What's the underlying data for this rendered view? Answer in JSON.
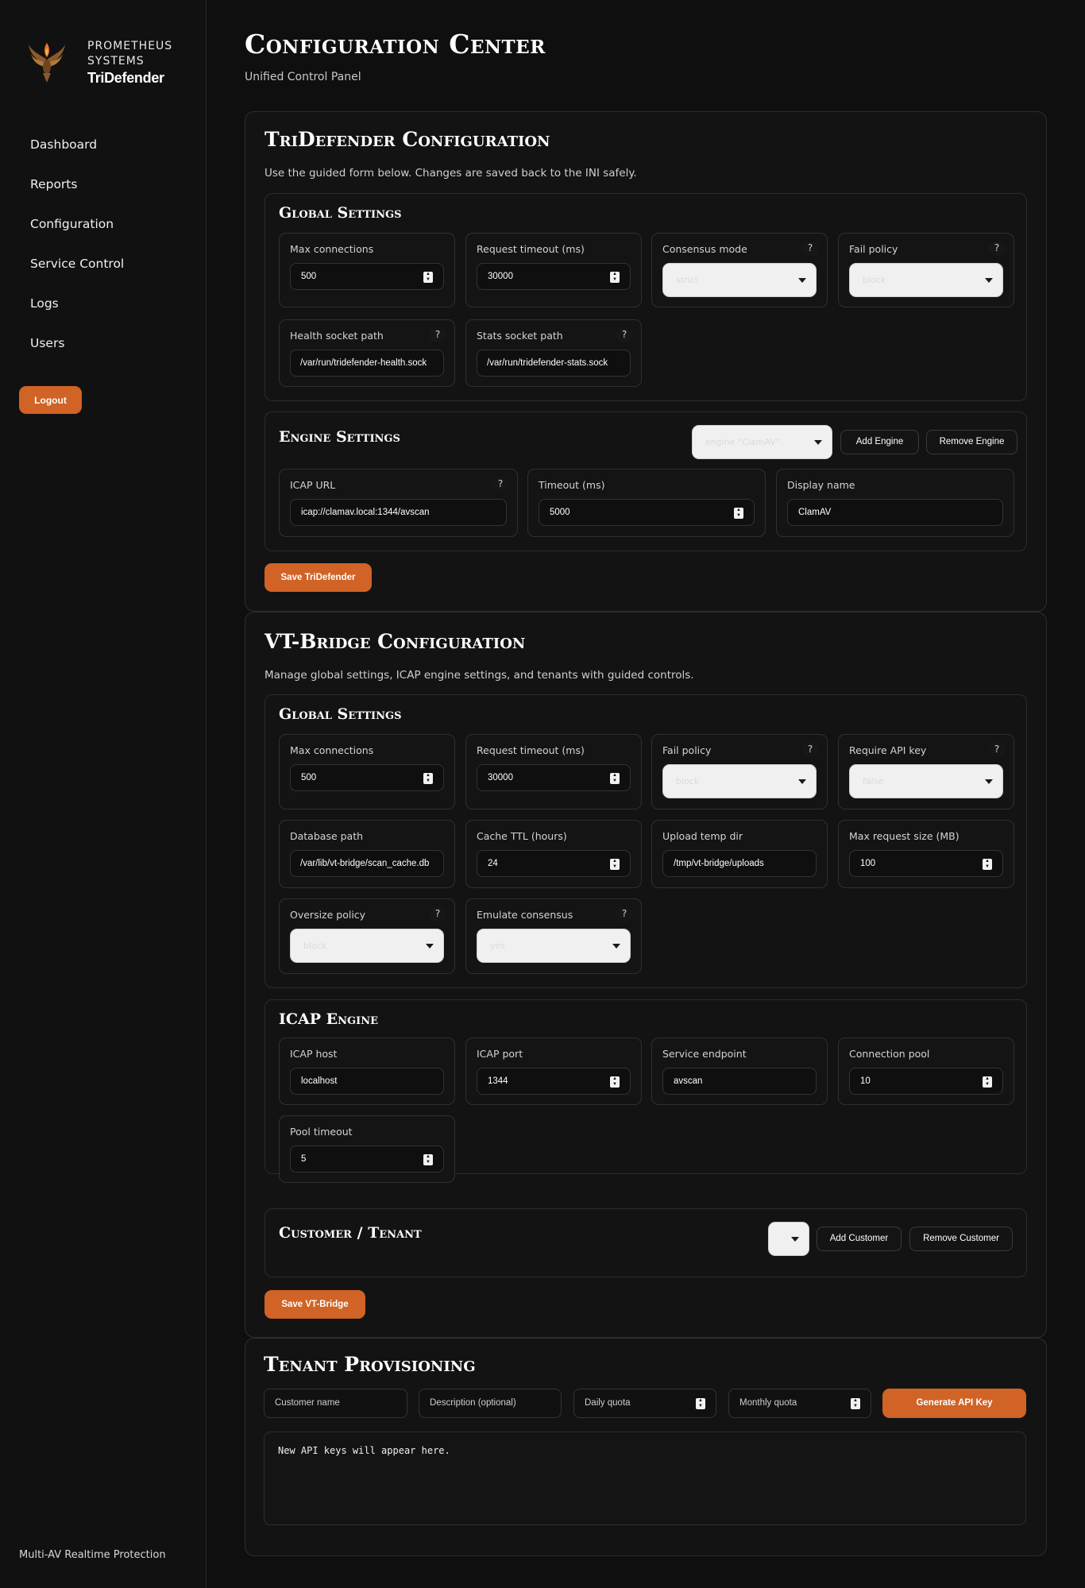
{
  "brand": {
    "company": "PROMETHEUS SYSTEMS",
    "product": "TriDefender",
    "logo_icon": "phoenix-flame-logo"
  },
  "nav": [
    "Dashboard",
    "Reports",
    "Configuration",
    "Service Control",
    "Logs",
    "Users"
  ],
  "logout_label": "Logout",
  "footer": "Multi-AV Realtime Protection",
  "page": {
    "title": "Configuration Center",
    "subtitle": "Unified Control Panel"
  },
  "colors": {
    "accent": "#d06325",
    "background": "#0f0f0f",
    "panel": "#131313"
  },
  "tridefender": {
    "title": "TriDefender Configuration",
    "description": "Use the guided form below. Changes are saved back to the INI safely.",
    "global": {
      "title": "Global Settings",
      "max_connections": {
        "label": "Max connections",
        "value": "500"
      },
      "request_timeout": {
        "label": "Request timeout (ms)",
        "value": "30000"
      },
      "consensus_mode": {
        "label": "Consensus mode",
        "value": "strict"
      },
      "fail_policy": {
        "label": "Fail policy",
        "value": "block"
      },
      "health_socket": {
        "label": "Health socket path",
        "value": "/var/run/tridefender-health.sock"
      },
      "stats_socket": {
        "label": "Stats socket path",
        "value": "/var/run/tridefender-stats.sock"
      }
    },
    "engine": {
      "title": "Engine Settings",
      "selector": "engine \"ClamAV\"",
      "add_label": "Add Engine",
      "remove_label": "Remove Engine",
      "icap_url": {
        "label": "ICAP URL",
        "value": "icap://clamav.local:1344/avscan"
      },
      "timeout": {
        "label": "Timeout (ms)",
        "value": "5000"
      },
      "display_name": {
        "label": "Display name",
        "value": "ClamAV"
      }
    },
    "save_label": "Save TriDefender"
  },
  "vtbridge": {
    "title": "VT-Bridge Configuration",
    "description": "Manage global settings, ICAP engine settings, and tenants with guided controls.",
    "global": {
      "title": "Global Settings",
      "max_connections": {
        "label": "Max connections",
        "value": "500"
      },
      "request_timeout": {
        "label": "Request timeout (ms)",
        "value": "30000"
      },
      "fail_policy": {
        "label": "Fail policy",
        "value": "block"
      },
      "require_api_key": {
        "label": "Require API key",
        "value": "false"
      },
      "database_path": {
        "label": "Database path",
        "value": "/var/lib/vt-bridge/scan_cache.db"
      },
      "cache_ttl": {
        "label": "Cache TTL (hours)",
        "value": "24"
      },
      "upload_temp": {
        "label": "Upload temp dir",
        "value": "/tmp/vt-bridge/uploads"
      },
      "max_request": {
        "label": "Max request size (MB)",
        "value": "100"
      },
      "oversize_policy": {
        "label": "Oversize policy",
        "value": "block"
      },
      "emulate_consensus": {
        "label": "Emulate consensus",
        "value": "yes"
      }
    },
    "icap": {
      "title": "ICAP Engine",
      "host": {
        "label": "ICAP host",
        "value": "localhost"
      },
      "port": {
        "label": "ICAP port",
        "value": "1344"
      },
      "endpoint": {
        "label": "Service endpoint",
        "value": "avscan"
      },
      "pool": {
        "label": "Connection pool",
        "value": "10"
      },
      "pool_timeout": {
        "label": "Pool timeout",
        "value": "5"
      }
    },
    "customer": {
      "title": "Customer / Tenant",
      "add_label": "Add Customer",
      "remove_label": "Remove Customer"
    },
    "save_label": "Save VT-Bridge"
  },
  "provisioning": {
    "title": "Tenant Provisioning",
    "customer_placeholder": "Customer name",
    "description_placeholder": "Description (optional)",
    "daily_placeholder": "Daily quota",
    "monthly_placeholder": "Monthly quota",
    "generate_label": "Generate API Key",
    "output_text": "New API keys will appear here."
  }
}
